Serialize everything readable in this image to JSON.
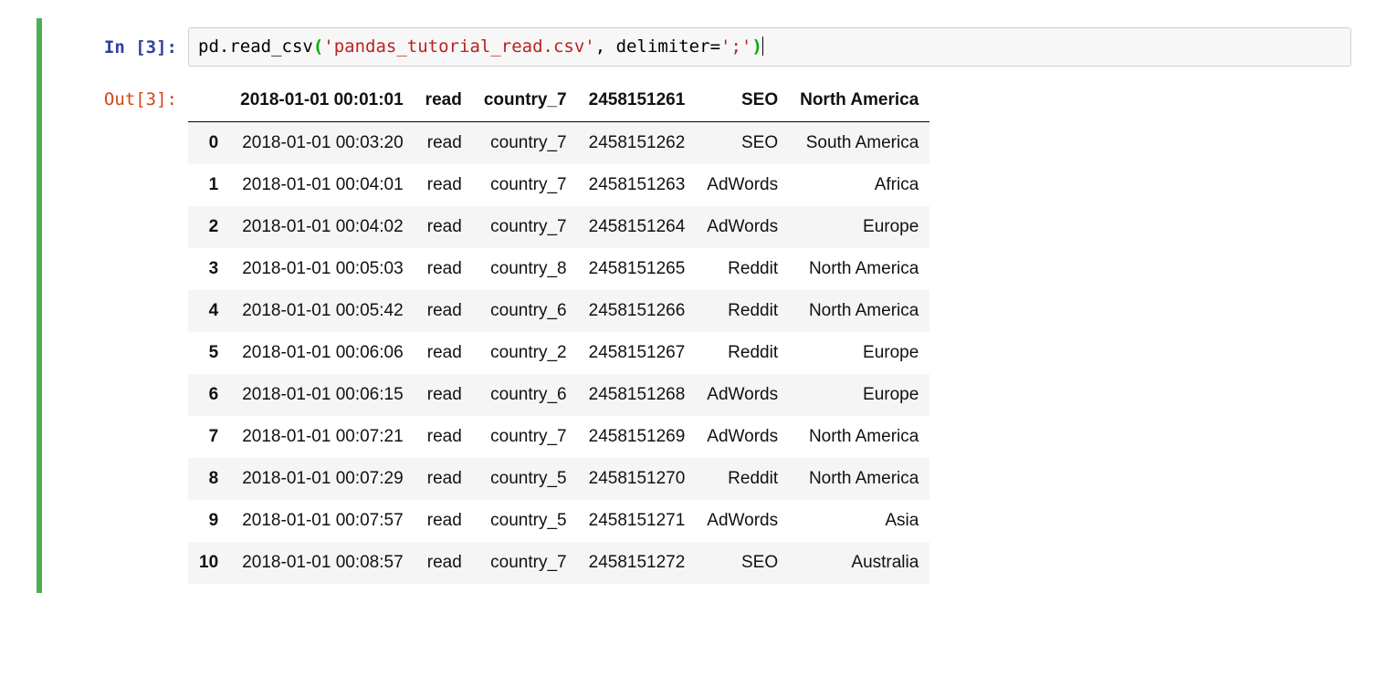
{
  "cell_in_prompt": "In [3]:",
  "cell_out_prompt": "Out[3]:",
  "code": {
    "prefix": "pd.read_csv",
    "open": "(",
    "arg1": "'pandas_tutorial_read.csv'",
    "comma": ", ",
    "kw": "delimiter",
    "eq": "=",
    "arg2": "';'",
    "close": ")"
  },
  "table": {
    "headers": [
      "2018-01-01 00:01:01",
      "read",
      "country_7",
      "2458151261",
      "SEO",
      "North America"
    ],
    "rows": [
      {
        "idx": "0",
        "cells": [
          "2018-01-01 00:03:20",
          "read",
          "country_7",
          "2458151262",
          "SEO",
          "South America"
        ]
      },
      {
        "idx": "1",
        "cells": [
          "2018-01-01 00:04:01",
          "read",
          "country_7",
          "2458151263",
          "AdWords",
          "Africa"
        ]
      },
      {
        "idx": "2",
        "cells": [
          "2018-01-01 00:04:02",
          "read",
          "country_7",
          "2458151264",
          "AdWords",
          "Europe"
        ]
      },
      {
        "idx": "3",
        "cells": [
          "2018-01-01 00:05:03",
          "read",
          "country_8",
          "2458151265",
          "Reddit",
          "North America"
        ]
      },
      {
        "idx": "4",
        "cells": [
          "2018-01-01 00:05:42",
          "read",
          "country_6",
          "2458151266",
          "Reddit",
          "North America"
        ]
      },
      {
        "idx": "5",
        "cells": [
          "2018-01-01 00:06:06",
          "read",
          "country_2",
          "2458151267",
          "Reddit",
          "Europe"
        ]
      },
      {
        "idx": "6",
        "cells": [
          "2018-01-01 00:06:15",
          "read",
          "country_6",
          "2458151268",
          "AdWords",
          "Europe"
        ]
      },
      {
        "idx": "7",
        "cells": [
          "2018-01-01 00:07:21",
          "read",
          "country_7",
          "2458151269",
          "AdWords",
          "North America"
        ]
      },
      {
        "idx": "8",
        "cells": [
          "2018-01-01 00:07:29",
          "read",
          "country_5",
          "2458151270",
          "Reddit",
          "North America"
        ]
      },
      {
        "idx": "9",
        "cells": [
          "2018-01-01 00:07:57",
          "read",
          "country_5",
          "2458151271",
          "AdWords",
          "Asia"
        ]
      },
      {
        "idx": "10",
        "cells": [
          "2018-01-01 00:08:57",
          "read",
          "country_7",
          "2458151272",
          "SEO",
          "Australia"
        ]
      }
    ]
  }
}
